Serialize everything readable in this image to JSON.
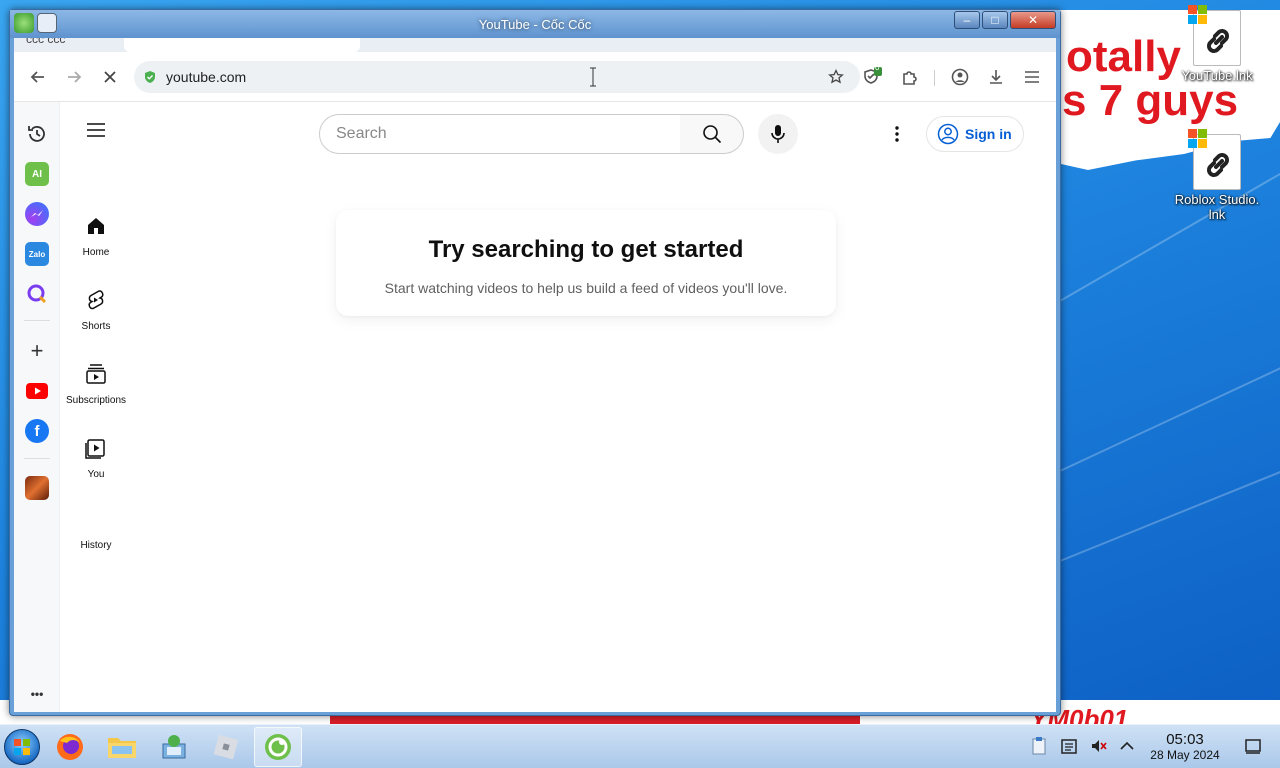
{
  "window": {
    "title": "YouTube - Cốc Cốc",
    "minimize_label": "–",
    "maximize_label": "□",
    "close_label": "✕"
  },
  "browser": {
    "profile_text": "ccc ccc",
    "url": "youtube.com",
    "extension_badge": "0"
  },
  "coccoc_sidebar": {
    "items": [
      {
        "name": "history",
        "label": ""
      },
      {
        "name": "ai-chat",
        "label": "AI"
      },
      {
        "name": "messenger",
        "label": ""
      },
      {
        "name": "zalo",
        "label": "Zalo"
      },
      {
        "name": "qms",
        "label": ""
      },
      {
        "name": "add",
        "label": "+"
      },
      {
        "name": "youtube",
        "label": ""
      },
      {
        "name": "facebook",
        "label": "f"
      },
      {
        "name": "game",
        "label": ""
      }
    ],
    "more_label": "•••"
  },
  "youtube": {
    "search_placeholder": "Search",
    "sign_in_label": "Sign in",
    "guide": {
      "home": "Home",
      "shorts": "Shorts",
      "subscriptions": "Subscriptions",
      "you": "You",
      "history": "History"
    },
    "empty_state": {
      "title": "Try searching to get started",
      "subtitle": "Start watching videos to help us build a feed of videos you'll love."
    }
  },
  "desktop": {
    "meme_line1": "otally",
    "meme_line2": "s 7 guys",
    "watermark": "YM0b01",
    "icons": [
      {
        "label": "YouTube.lnk"
      },
      {
        "label": "Roblox Studio.\nlnk"
      }
    ]
  },
  "taskbar": {
    "time": "05:03",
    "date": "28 May 2024"
  },
  "colors": {
    "youtube_red": "#ff0000",
    "link_blue": "#065fd4",
    "coccoc_green": "#6ec04b"
  }
}
